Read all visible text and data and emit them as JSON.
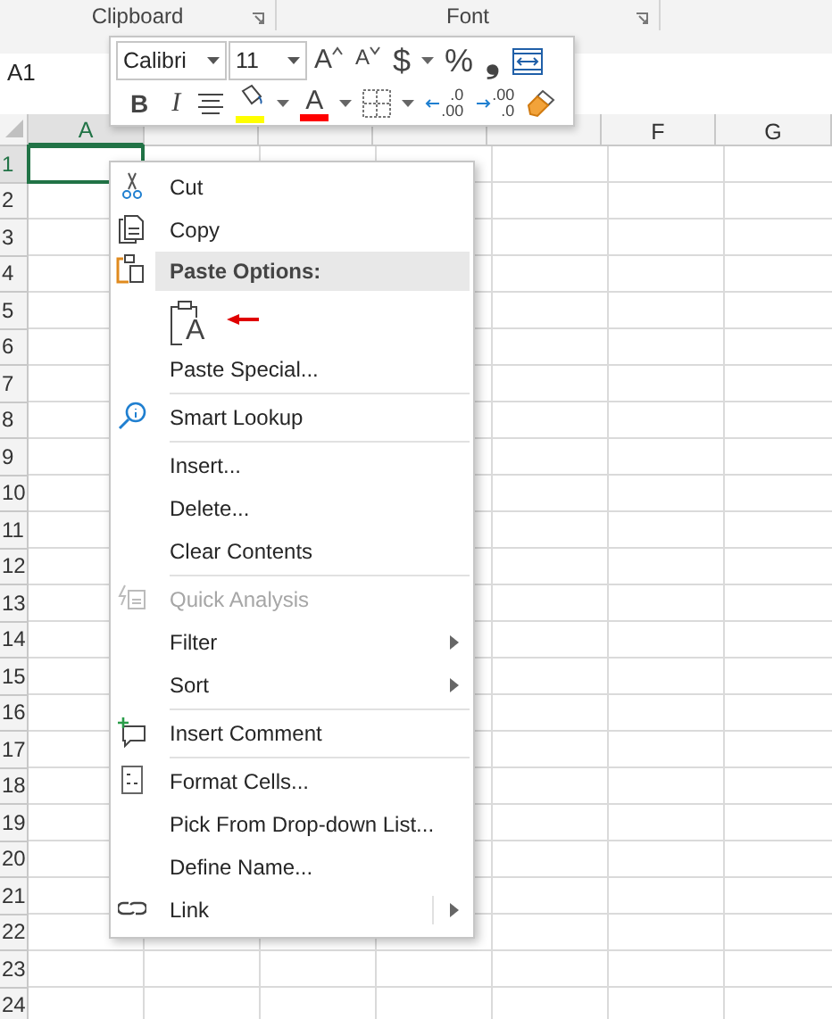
{
  "ribbon_groups": [
    {
      "label": "Clipboard"
    },
    {
      "label": "Font"
    }
  ],
  "name_box": "A1",
  "mini_toolbar": {
    "font": "Calibri",
    "size": "11",
    "row1": [
      {
        "kind": "grow-font",
        "label": "A",
        "dropdown": false
      },
      {
        "kind": "shrink-font",
        "label": "A",
        "dropdown": false
      },
      {
        "kind": "currency",
        "label": "$",
        "dropdown": true
      },
      {
        "kind": "percent",
        "label": "%",
        "dropdown": false
      },
      {
        "kind": "comma",
        "label": "❟",
        "dropdown": false
      },
      {
        "kind": "wrap",
        "dropdown": false
      }
    ],
    "row2": [
      {
        "kind": "bold",
        "label": "B",
        "dropdown": false
      },
      {
        "kind": "italic",
        "label": "I",
        "dropdown": false
      },
      {
        "kind": "align",
        "dropdown": false
      },
      {
        "kind": "fill-color",
        "color": "#ffff00",
        "dropdown": true
      },
      {
        "kind": "font-color",
        "label": "A",
        "color": "#ff0000",
        "dropdown": true
      },
      {
        "kind": "borders",
        "dropdown": true
      },
      {
        "kind": "increase-decimal",
        "lines": [
          ".0",
          ".00"
        ],
        "dropdown": false
      },
      {
        "kind": "decrease-decimal",
        "lines": [
          ".00",
          ".0"
        ],
        "dropdown": false
      },
      {
        "kind": "format-painter",
        "dropdown": false
      }
    ]
  },
  "grid": {
    "columns": [
      {
        "label": "A",
        "selected": true
      },
      {
        "selected": false
      },
      {
        "selected": false
      },
      {
        "selected": false
      },
      {
        "selected": false
      },
      {
        "label": "F",
        "selected": false
      },
      {
        "label": "G",
        "selected": false
      }
    ],
    "rows": [
      {
        "label": "1",
        "selected": true
      },
      {
        "label": "2",
        "selected": false
      },
      {
        "label": "3",
        "selected": false
      },
      {
        "label": "4",
        "selected": false
      },
      {
        "label": "5",
        "selected": false
      },
      {
        "label": "6",
        "selected": false
      },
      {
        "label": "7",
        "selected": false
      },
      {
        "label": "8",
        "selected": false
      },
      {
        "label": "9",
        "selected": false
      },
      {
        "label": "10",
        "selected": false
      },
      {
        "label": "11",
        "selected": false
      },
      {
        "label": "12",
        "selected": false
      },
      {
        "label": "13",
        "selected": false
      },
      {
        "label": "14",
        "selected": false
      },
      {
        "label": "15",
        "selected": false
      },
      {
        "label": "16",
        "selected": false
      },
      {
        "label": "17",
        "selected": false
      },
      {
        "label": "18",
        "selected": false
      },
      {
        "label": "19",
        "selected": false
      },
      {
        "label": "20",
        "selected": false
      },
      {
        "label": "21",
        "selected": false
      },
      {
        "label": "22",
        "selected": false
      },
      {
        "label": "23",
        "selected": false
      },
      {
        "label": "24",
        "selected": false
      }
    ]
  },
  "context_menu": [
    {
      "kind": "item",
      "label": "Cut",
      "disabled": false,
      "submenu": false,
      "divider_above": false
    },
    {
      "kind": "item",
      "label": "Copy",
      "disabled": false,
      "submenu": false,
      "divider_above": false
    },
    {
      "kind": "header",
      "label": "Paste Options:"
    },
    {
      "kind": "paste-options",
      "glyph": "A"
    },
    {
      "kind": "item",
      "label": "Paste Special...",
      "disabled": false,
      "submenu": false,
      "divider_above": false
    },
    {
      "kind": "item",
      "label": "Smart Lookup",
      "disabled": false,
      "submenu": false,
      "divider_above": true
    },
    {
      "kind": "item",
      "label": "Insert...",
      "disabled": false,
      "submenu": false,
      "divider_above": true
    },
    {
      "kind": "item",
      "label": "Delete...",
      "disabled": false,
      "submenu": false,
      "divider_above": false
    },
    {
      "kind": "item",
      "label": "Clear Contents",
      "disabled": false,
      "submenu": false,
      "divider_above": false
    },
    {
      "kind": "item",
      "label": "Quick Analysis",
      "disabled": true,
      "submenu": false,
      "divider_above": true
    },
    {
      "kind": "item",
      "label": "Filter",
      "disabled": false,
      "submenu": true,
      "divider_above": false
    },
    {
      "kind": "item",
      "label": "Sort",
      "disabled": false,
      "submenu": true,
      "divider_above": false
    },
    {
      "kind": "item",
      "label": "Insert Comment",
      "disabled": false,
      "submenu": false,
      "divider_above": true
    },
    {
      "kind": "item",
      "label": "Format Cells...",
      "disabled": false,
      "submenu": false,
      "divider_above": true
    },
    {
      "kind": "item",
      "label": "Pick From Drop-down List...",
      "disabled": false,
      "submenu": false,
      "divider_above": false
    },
    {
      "kind": "item",
      "label": "Define Name...",
      "disabled": false,
      "submenu": false,
      "divider_above": false
    },
    {
      "kind": "item",
      "label": "Link",
      "disabled": false,
      "submenu": true,
      "split": true,
      "divider_above": false
    }
  ]
}
